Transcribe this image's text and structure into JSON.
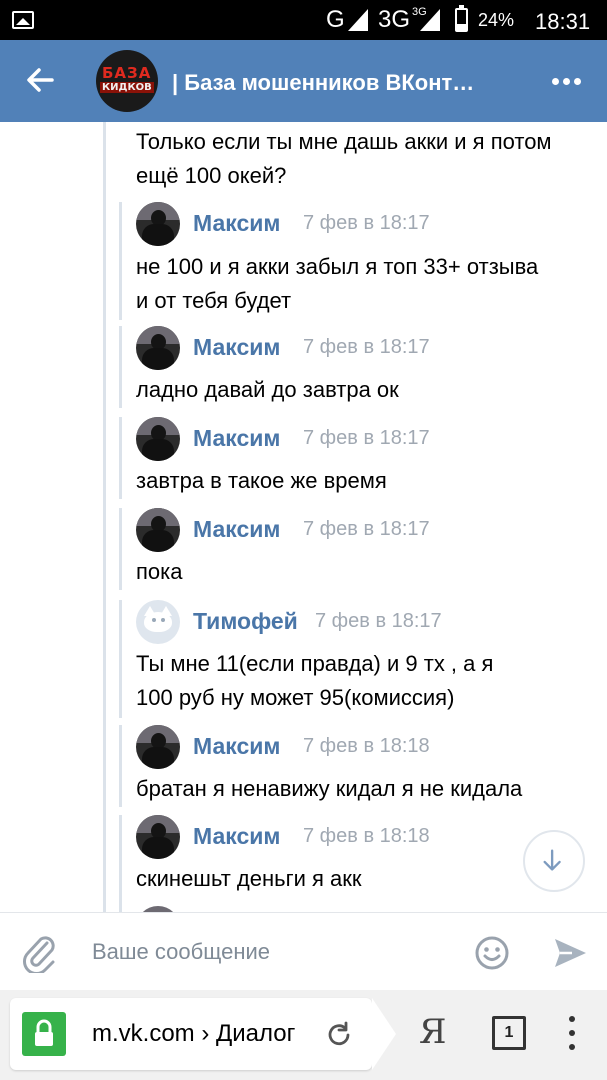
{
  "status_bar": {
    "network_g": "G",
    "network_3g": "3G",
    "network_3g_sup": "3G",
    "battery": "24%",
    "time": "18:31",
    "icons": [
      "gallery-notification-icon",
      "signal-icon",
      "battery-icon"
    ]
  },
  "header": {
    "title": "| База мошенников ВКонт…",
    "avatar_line1": "БАЗА",
    "avatar_line2": "КИДКОВ",
    "back_icon": "arrow-left-icon",
    "more_icon": "more-dots-icon"
  },
  "chat": {
    "top_text": "Только если ты мне дашь акки и я потом ещё 100 окей?",
    "messages": [
      {
        "name": "Максим",
        "time": "7 фев в 18:17",
        "text": "не 100 и я акки забыл я топ 33+ отзыва и от тебя будет"
      },
      {
        "name": "Максим",
        "time": "7 фев в 18:17",
        "text": "ладно давай до завтра ок"
      },
      {
        "name": "Максим",
        "time": "7 фев в 18:17",
        "text": "завтра в такое же время"
      },
      {
        "name": "Максим",
        "time": "7 фев в 18:17",
        "text": "пока"
      },
      {
        "name": "Тимофей",
        "time": "7 фев в 18:17",
        "text": "Ты мне 11(если правда) и 9 тх , а я 100 руб ну может 95(комиссия)"
      },
      {
        "name": "Максим",
        "time": "7 фев в 18:18",
        "text": "братан я ненавижу кидал я не кидала"
      },
      {
        "name": "Максим",
        "time": "7 фев в 18:18",
        "text": "скинешьт деньги я акк"
      }
    ]
  },
  "composer": {
    "placeholder": "Ваше сообщение",
    "value": ""
  },
  "browser": {
    "url": "m.vk.com › Диалог",
    "yandex_label": "Я",
    "tab_count": "1"
  },
  "colors": {
    "header_bg": "#5181b8",
    "name_color": "#4a76a8",
    "time_color": "#a0a8b2",
    "lock_green": "#36b24a"
  }
}
